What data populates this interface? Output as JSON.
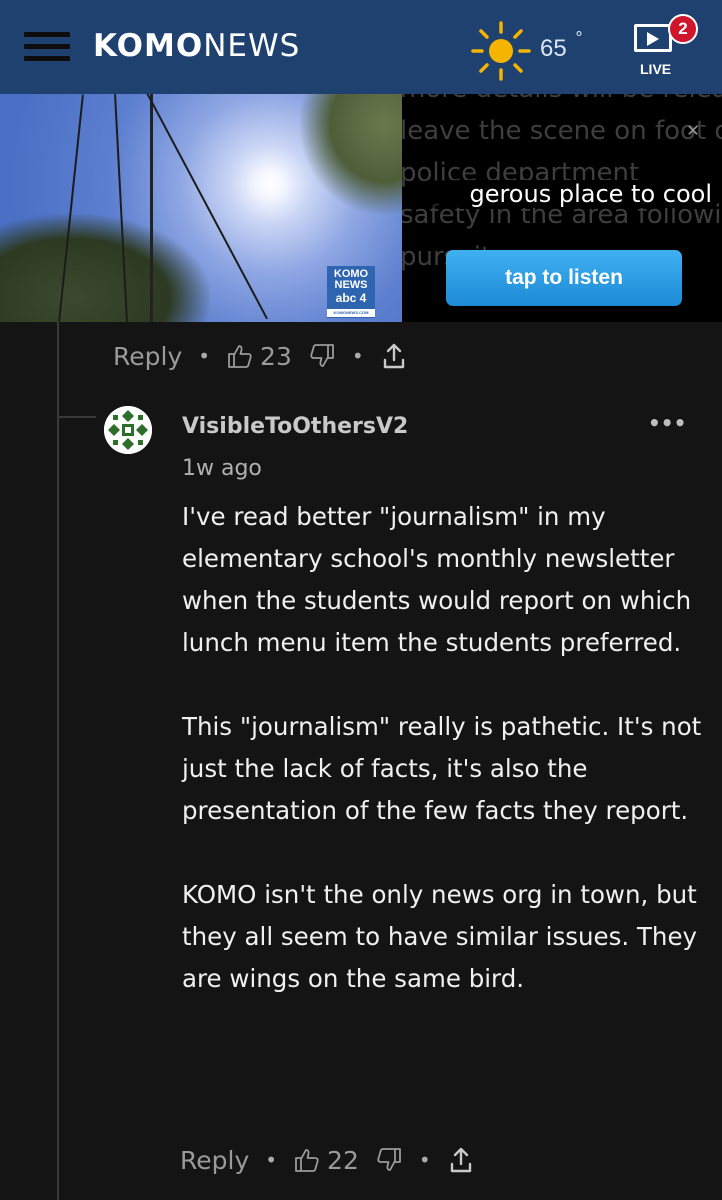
{
  "header": {
    "brand_bold": "KOMO",
    "brand_light": "NEWS",
    "weather_temp": "65",
    "weather_unit": "°",
    "weather_icon": "sun-icon",
    "live_badge_count": "2",
    "live_label": "LIVE",
    "colors": {
      "bar": "#1f4170",
      "badge": "#d0162c",
      "sun": "#f4b400"
    }
  },
  "player": {
    "background_article_lines": [
      "more details will be released? Did the shooter",
      "leave the scene on foot or in a",
      "police department",
      "safety in the area following",
      "pursuit"
    ],
    "headline_fragment": "gerous place to cool",
    "video_bug": {
      "line1": "KOMO",
      "line2": "NEWS",
      "line3": "abc 4",
      "line4": "KOMONEWS.COM"
    },
    "tap_to_listen": "tap to listen",
    "close_glyph": "✕"
  },
  "parent_comment": {
    "reply_label": "Reply",
    "likes": "23"
  },
  "comment": {
    "username": "VisibleToOthersV2",
    "timestamp": "1w ago",
    "more_glyph": "•••",
    "paragraphs": [
      "I've read better \"journalism\" in my elementary school's monthly newsletter when the students would report on which lunch menu item the students preferred.",
      "This \"journalism\" really is pathetic. It's not just the lack of facts, it's also the presentation of the few facts they report.",
      "KOMO isn't the only news org in town, but they all seem to have similar issues. They are wings on the same bird."
    ],
    "reply_label": "Reply",
    "likes": "22"
  }
}
